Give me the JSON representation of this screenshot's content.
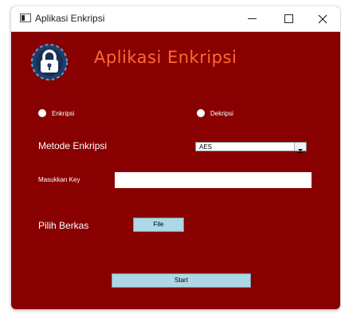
{
  "window": {
    "title": "Aplikasi Enkripsi",
    "background_color": "#880000",
    "controls": {
      "minimize": "minimize-icon",
      "maximize": "maximize-icon",
      "close": "close-icon"
    }
  },
  "header": {
    "logo_icon": "padlock-icon",
    "title": "Aplikasi Enkripsi",
    "title_color": "#ff6a33"
  },
  "mode": {
    "options": [
      {
        "label": "Enkripsi",
        "selected": false
      },
      {
        "label": "Dekripsi",
        "selected": false
      }
    ]
  },
  "method": {
    "label": "Metode Enkripsi",
    "selected_value": "AES"
  },
  "key": {
    "label": "Masukkan Key",
    "value": ""
  },
  "file": {
    "label": "Pilih Berkas",
    "button_label": "File"
  },
  "actions": {
    "start_label": "Start",
    "button_color": "#add8e6"
  }
}
